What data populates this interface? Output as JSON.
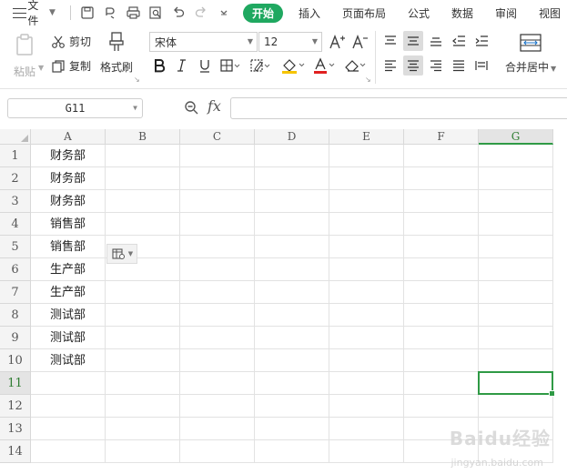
{
  "menubar": {
    "file_label": "文件",
    "quick_access_icons": [
      "save-icon",
      "undo-history-icon",
      "print-icon",
      "print-preview-icon",
      "undo-icon",
      "redo-icon",
      "customize-chevron-icon"
    ],
    "tabs": [
      {
        "label": "开始",
        "active": true
      },
      {
        "label": "插入",
        "active": false
      },
      {
        "label": "页面布局",
        "active": false
      },
      {
        "label": "公式",
        "active": false
      },
      {
        "label": "数据",
        "active": false
      },
      {
        "label": "审阅",
        "active": false
      },
      {
        "label": "视图",
        "active": false
      }
    ]
  },
  "ribbon": {
    "paste_label": "粘贴",
    "cut_label": "剪切",
    "copy_label": "复制",
    "format_painter_label": "格式刷",
    "font_name": "宋体",
    "font_size": "12",
    "merge_label": "合并居中"
  },
  "formula_bar": {
    "name_box": "G11",
    "fx_label": "fx",
    "formula_value": ""
  },
  "sheet": {
    "columns": [
      "A",
      "B",
      "C",
      "D",
      "E",
      "F",
      "G"
    ],
    "selected_column": "G",
    "rows": [
      "1",
      "2",
      "3",
      "4",
      "5",
      "6",
      "7",
      "8",
      "9",
      "10",
      "11",
      "12",
      "13",
      "14"
    ],
    "selected_row": "11",
    "col_a_values": [
      "财务部",
      "财务部",
      "财务部",
      "销售部",
      "销售部",
      "生产部",
      "生产部",
      "测试部",
      "测试部",
      "测试部",
      "",
      "",
      "",
      ""
    ]
  },
  "watermark": {
    "text": "Baidu经验",
    "sub": "jingyan.baidu.com"
  },
  "colors": {
    "accent": "#1fa860",
    "selection": "#2f9a45"
  }
}
